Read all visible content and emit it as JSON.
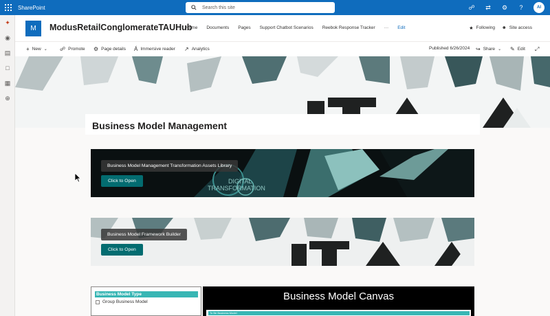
{
  "suite": {
    "app_name": "SharePoint",
    "search_placeholder": "Search this site",
    "avatar_initials": "AI"
  },
  "site": {
    "logo_letter": "M",
    "title": "ModusRetailConglomerateTAUHub",
    "nav": [
      "Home",
      "Documents",
      "Pages",
      "Support Chatbot Scenarios",
      "Reebok Response Tracker",
      "···"
    ],
    "nav_edit": "Edit",
    "following": "Following",
    "site_access": "Site access"
  },
  "commands": {
    "new": "New",
    "promote": "Promote",
    "page_details": "Page details",
    "immersive_reader": "Immersive reader",
    "analytics": "Analytics",
    "published": "Published 6/26/2024",
    "share": "Share",
    "edit": "Edit"
  },
  "page": {
    "title": "Business Model Management"
  },
  "cards": [
    {
      "label": "Business Model Management Transformation Assets Library",
      "button": "Click to Open",
      "art_text_1": "DIGITAL",
      "art_text_2": "TRANSFORMATION"
    },
    {
      "label": "Business Model Framework Builder",
      "button": "Click to Open"
    }
  ],
  "bm_type": {
    "header": "Business Model Type",
    "item": "Group Business Model"
  },
  "canvas": {
    "title": "Business Model Canvas",
    "subheader": "To Be Business Model"
  },
  "colors": {
    "suite_blue": "#0f6cbd",
    "teal_button": "#036c70",
    "teal_header": "#38b6b4"
  }
}
